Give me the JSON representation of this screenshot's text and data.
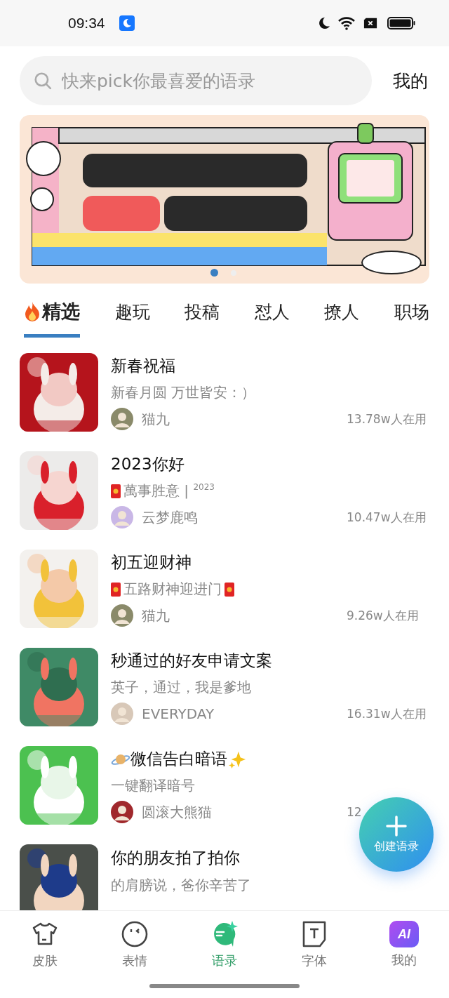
{
  "status_bar": {
    "time": "09:34"
  },
  "search": {
    "placeholder": "快来pick你最喜爱的语录"
  },
  "header_link": "我的",
  "banner": {
    "kind": "picture",
    "dots": [
      {
        "selected": true
      },
      {
        "selected": false
      }
    ]
  },
  "tabs": [
    {
      "label": "精选",
      "selected": true,
      "hot": true
    },
    {
      "label": "趣玩",
      "selected": false,
      "hot": false
    },
    {
      "label": "投稿",
      "selected": false,
      "hot": false
    },
    {
      "label": "怼人",
      "selected": false,
      "hot": false
    },
    {
      "label": "撩人",
      "selected": false,
      "hot": false
    },
    {
      "label": "职场",
      "selected": false,
      "hot": false
    }
  ],
  "items": [
    {
      "title": "新春祝福",
      "subtitle": "新春月圆 万世皆安：）",
      "author": "猫九",
      "usage": "13.78w人在用"
    },
    {
      "title": "2023你好",
      "subtitle": "萬事胜意 | $^{2023}$",
      "subtitle_icon_before": true,
      "author": "云梦鹿鸣",
      "usage": "10.47w人在用"
    },
    {
      "title": "初五迎财神",
      "subtitle": "五路财神迎进门",
      "subtitle_icon_before": true,
      "subtitle_icon_after": true,
      "author": "猫九",
      "usage": "9.26w人在用"
    },
    {
      "title": "秒通过的好友申请文案",
      "subtitle": "英子，通过，我是爹地",
      "author": "EVERYDAY",
      "usage": "16.31w人在用"
    },
    {
      "title": "微信告白暗语",
      "title_emoji": true,
      "subtitle": "一键翻译暗号",
      "author": "圆滚大熊猫",
      "usage": "12"
    },
    {
      "title": "你的朋友拍了拍你",
      "subtitle": "的肩膀说，爸你辛苦了"
    }
  ],
  "fab": {
    "label": "创建语录"
  },
  "nav": [
    {
      "label": "皮肤",
      "selected": false
    },
    {
      "label": "表情",
      "selected": false
    },
    {
      "label": "语录",
      "selected": true
    },
    {
      "label": "字体",
      "selected": false
    },
    {
      "label": "我的",
      "badge": "AI",
      "selected": false
    }
  ]
}
